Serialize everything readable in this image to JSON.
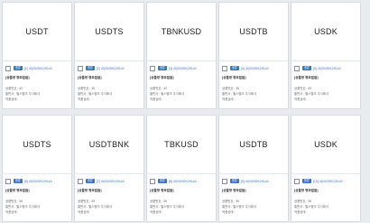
{
  "cards": [
    {
      "symbol": "USDT",
      "badge": "종류",
      "code": "[1] 40202501291x0",
      "title": "[상품명 정보없음]",
      "line1": "상품번호 : 42",
      "line2": "출판사 : 필스뱅크 주식회사",
      "line3": "작품상태 : "
    },
    {
      "symbol": "USDTS",
      "badge": "종류",
      "code": "[2] 40202501291x0",
      "title": "[상품명 정보없음]",
      "line1": "상품번호 : 35",
      "line2": "출판사 : 필스뱅크 주식회사",
      "line3": "작품상태 : "
    },
    {
      "symbol": "TBNKUSD",
      "badge": "종류",
      "code": "[3] 40202501291x0",
      "title": "[상품명 정보없음]",
      "line1": "상품번호 : 42",
      "line2": "출판사 : 필스뱅크 주식회사",
      "line3": "작품상태 : "
    },
    {
      "symbol": "USDTB",
      "badge": "종류",
      "code": "[4] 40202501291x0",
      "title": "[상품명 정보없음]",
      "line1": "상품번호 : 35",
      "line2": "출판사 : 필스뱅크 주식회사",
      "line3": "작품상태 : "
    },
    {
      "symbol": "USDK",
      "badge": "종류",
      "code": "[5] 40202501291x0",
      "title": "[상품명 정보없음]",
      "line1": "상품번호 : 09",
      "line2": "출판사 : 필스뱅크 주식회사",
      "line3": "작품상태 : "
    },
    {
      "symbol": "USDTS",
      "badge": "종류",
      "code": "[6] 40202501291x0",
      "title": "[상품명 정보없음]",
      "line1": "상품번호 : 36",
      "line2": "출판사 : 필스뱅크 주식회사",
      "line3": "작품상태 : "
    },
    {
      "symbol": "USDTBNK",
      "badge": "종류",
      "code": "[7] 40202501291x0",
      "title": "[상품명 정보없음]",
      "line1": "상품번호 : 09",
      "line2": "출판사 : 필스뱅크 주식회사",
      "line3": "작품상태 : "
    },
    {
      "symbol": "TBKUSD",
      "badge": "종류",
      "code": "[8] 40202501291x0",
      "title": "[상품명 정보없음]",
      "line1": "상품번호 : 36",
      "line2": "출판사 : 필스뱅크 주식회사",
      "line3": "작품상태 : "
    },
    {
      "symbol": "USDTB",
      "badge": "종류",
      "code": "[9] 40202501291x0",
      "title": "[상품명 정보없음]",
      "line1": "상품번호 : 36",
      "line2": "출판사 : 필스뱅크 주식회사",
      "line3": "작품상태 : "
    },
    {
      "symbol": "USDK",
      "badge": "종류",
      "code": "[10] 40202501291x0",
      "title": "[상품명 정보없음]",
      "line1": "상품번호 : 36",
      "line2": "출판사 : 필스뱅크 주식회사",
      "line3": "작품상태 : "
    }
  ]
}
